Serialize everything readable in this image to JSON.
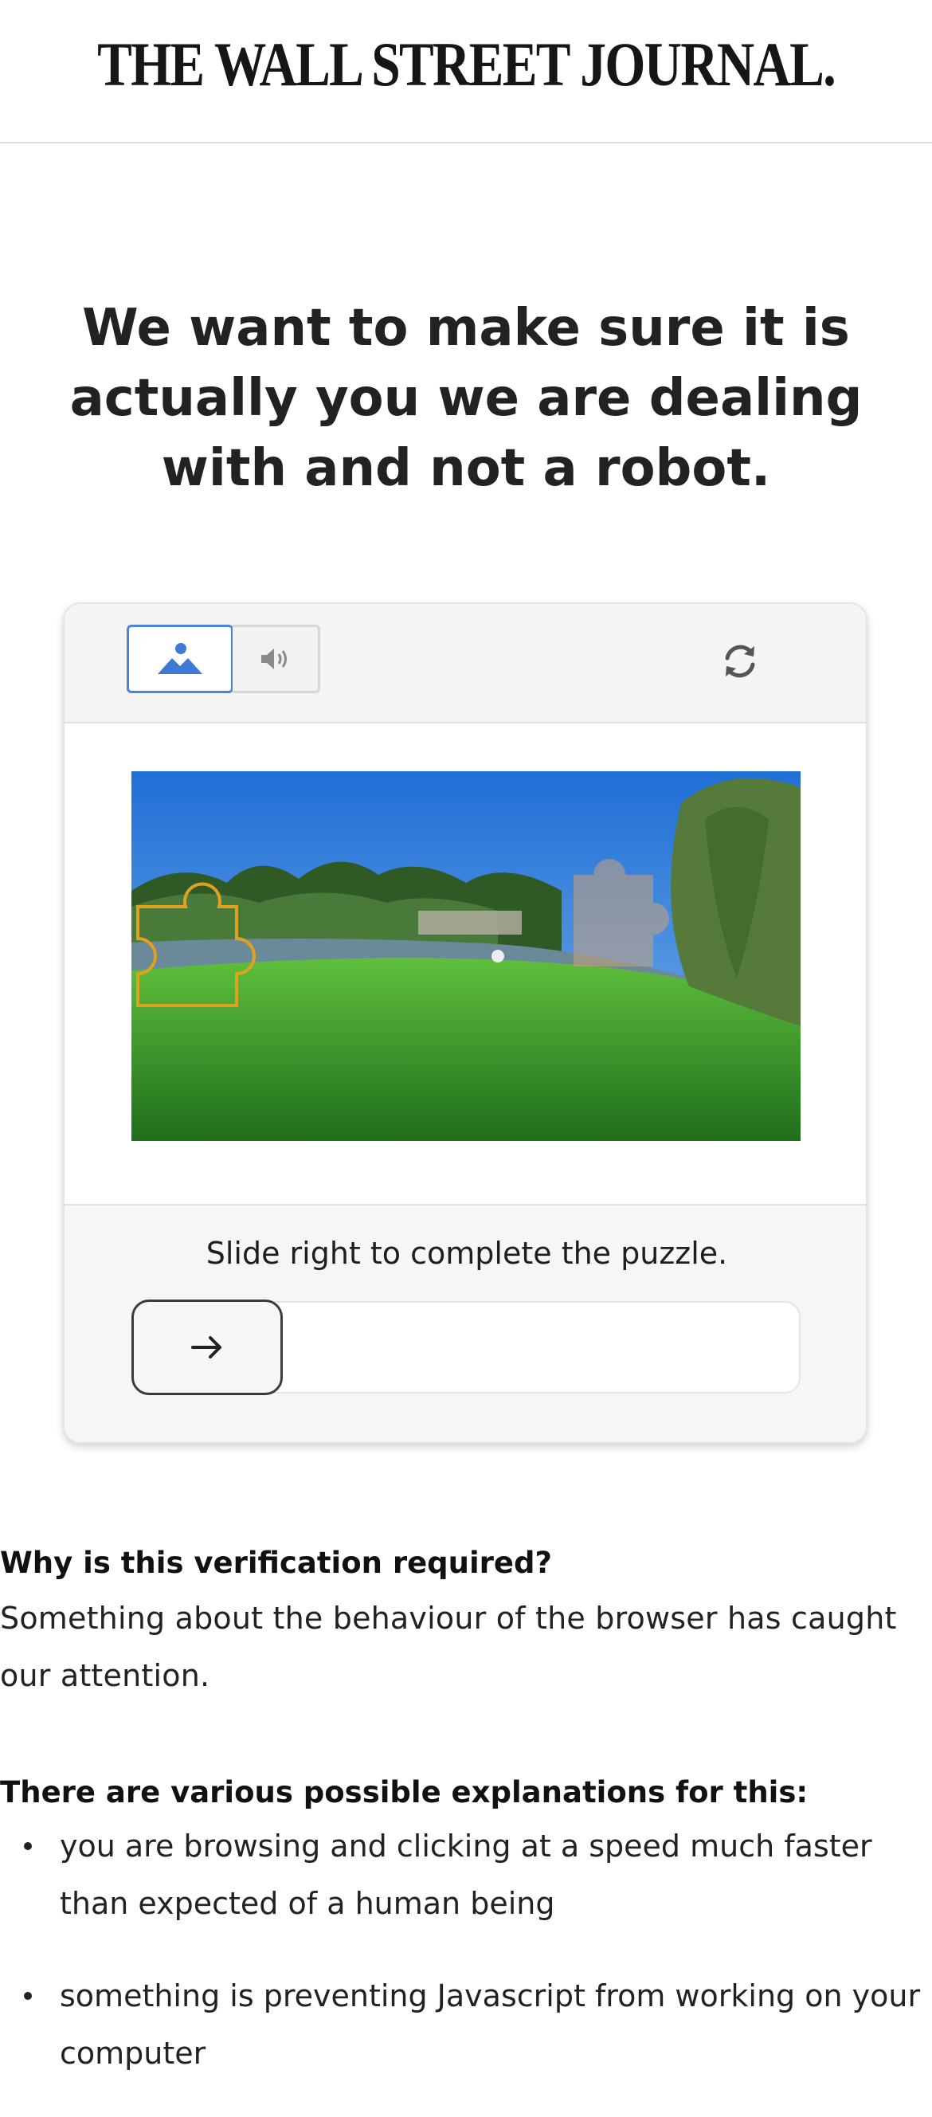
{
  "header": {
    "logo_text": "THE WALL STREET JOURNAL."
  },
  "headline": "We want to make sure it is actually you we are dealing with and not a robot.",
  "captcha": {
    "mode_image_icon": "image-mode-icon",
    "mode_audio_icon": "audio-mode-icon",
    "refresh_icon": "refresh-icon",
    "instruction": "Slide right to complete the puzzle.",
    "slider_handle_icon": "arrow-right-icon",
    "accent_color": "#4a86d8"
  },
  "explanation": {
    "why_heading": "Why is this verification required?",
    "why_text": "Something about the behaviour of the browser has caught our attention.",
    "reasons_heading": "There are various possible explanations for this:",
    "reasons": [
      "you are browsing and clicking at a speed much faster than expected of a human being",
      "something is preventing Javascript from working on your computer"
    ]
  }
}
